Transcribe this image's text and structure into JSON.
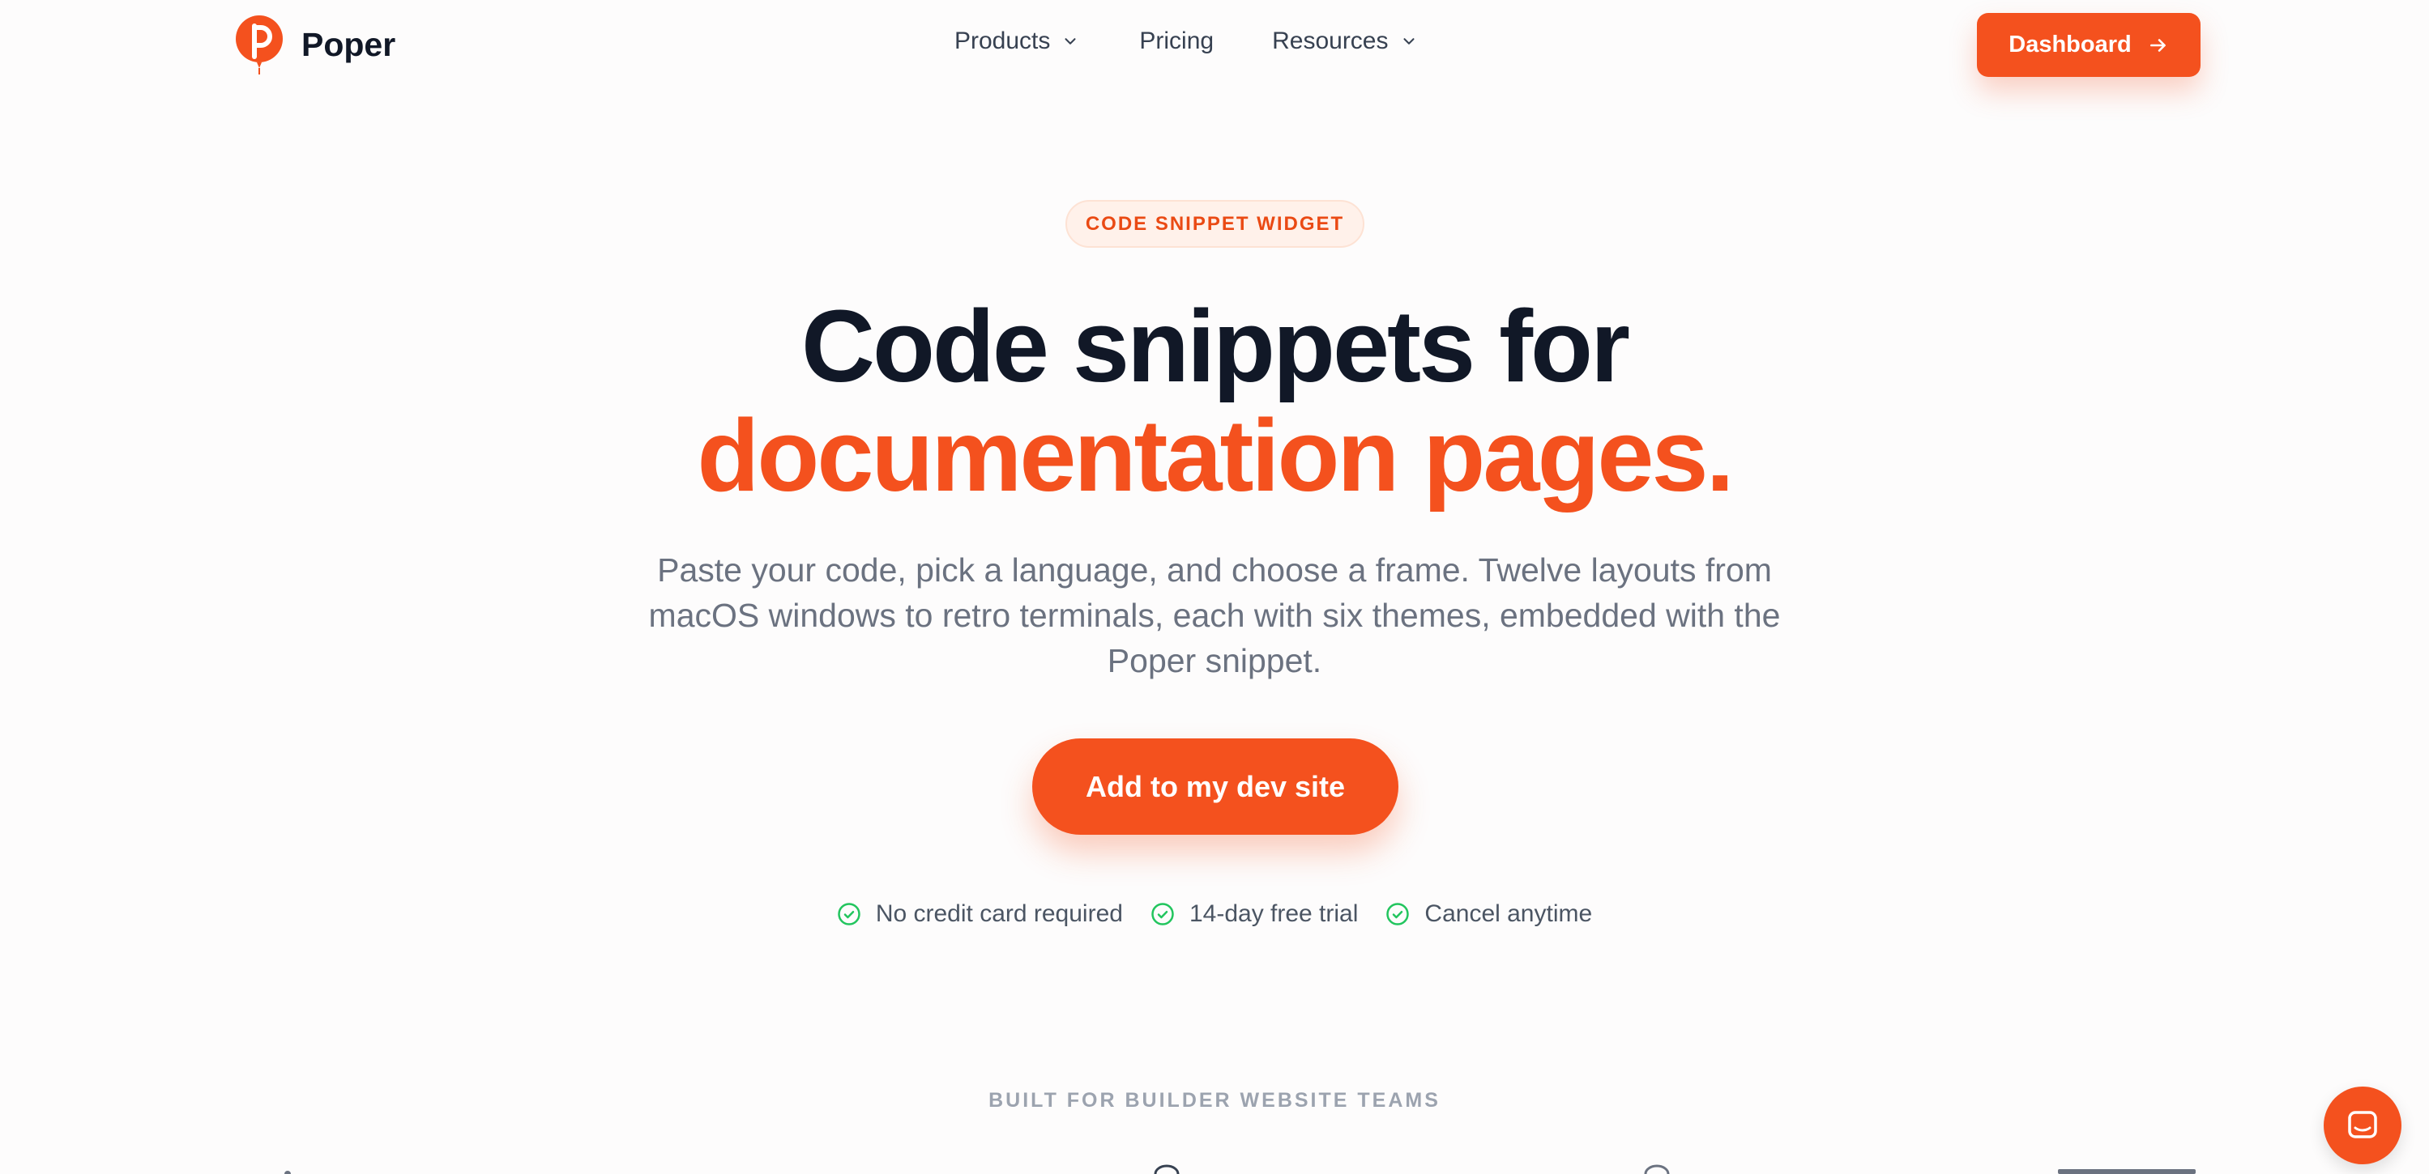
{
  "brand": {
    "name": "Poper",
    "icon": "balloon-p-logo",
    "accent": "#f4511e"
  },
  "nav": {
    "products": "Products",
    "pricing": "Pricing",
    "resources": "Resources"
  },
  "header": {
    "dashboard_label": "Dashboard",
    "dashboard_icon": "arrow-right-icon"
  },
  "hero": {
    "badge": "CODE SNIPPET WIDGET",
    "title_line1": "Code snippets for",
    "title_line2": "documentation pages.",
    "subtitle": "Paste your code, pick a language, and choose a frame. Twelve layouts from macOS windows to retro terminals, each with six themes, embedded with the Poper snippet.",
    "cta_label": "Add to my dev site",
    "checks": [
      "No credit card required",
      "14-day free trial",
      "Cancel anytime"
    ],
    "check_color": "#22c55e"
  },
  "social_proof": {
    "heading": "BUILT FOR BUILDER WEBSITE TEAMS"
  },
  "chat": {
    "icon": "chat-bubble-icon"
  }
}
